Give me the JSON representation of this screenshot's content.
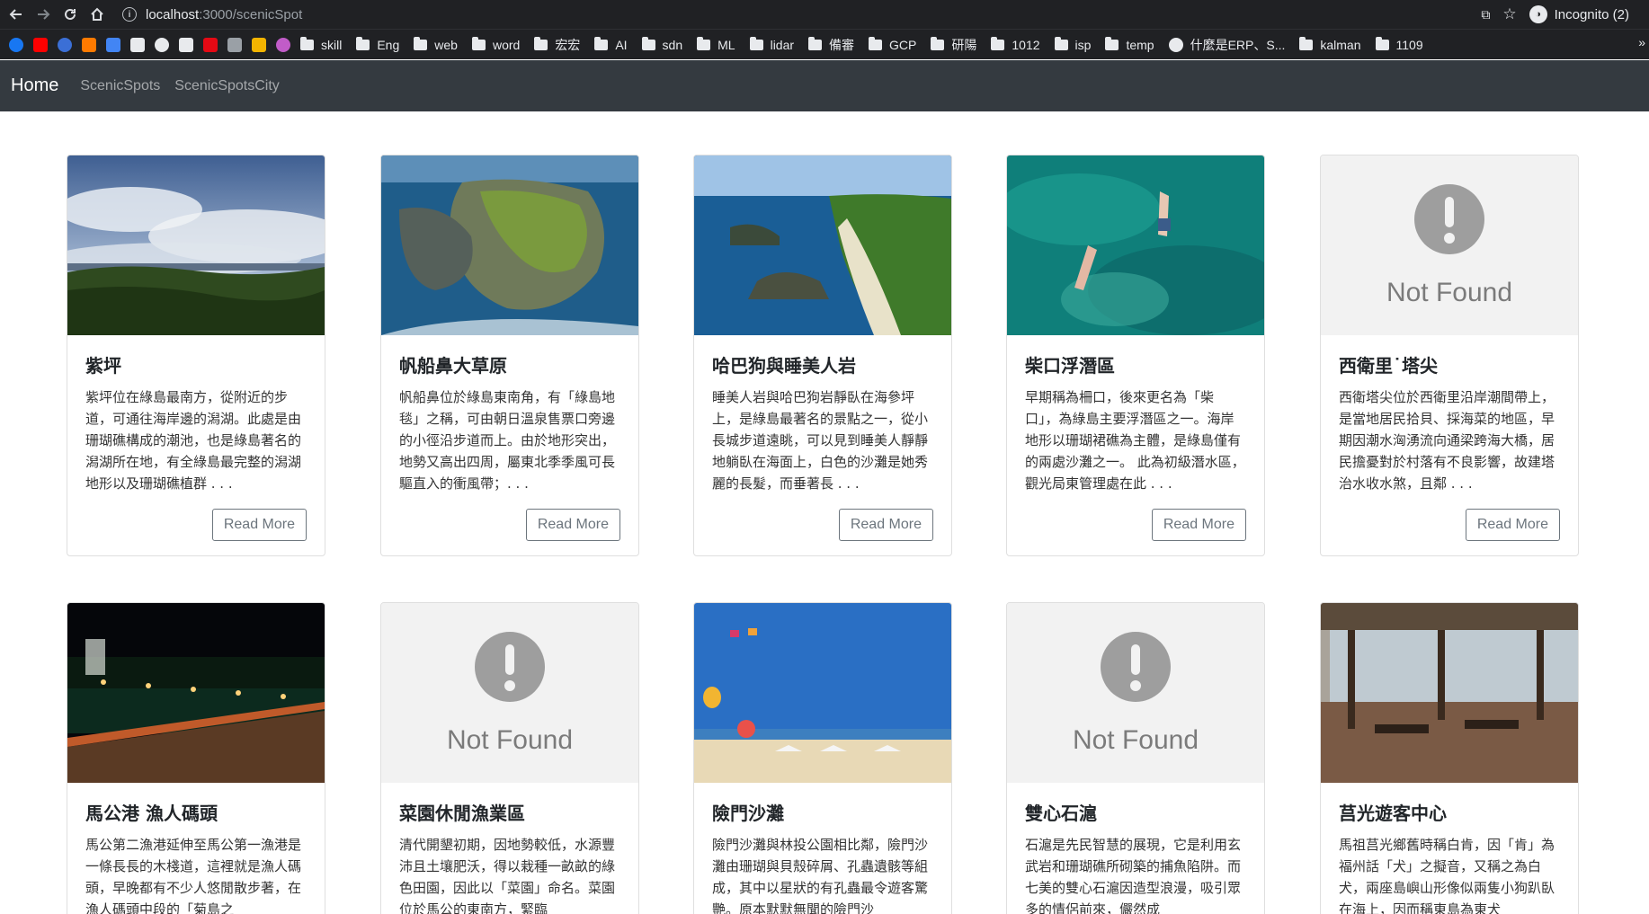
{
  "browser": {
    "url_host": "localhost",
    "url_path": ":3000/scenicSpot",
    "incognito_label": "Incognito (2)",
    "bookmarks": [
      "skill",
      "Eng",
      "web",
      "word",
      "宏宏",
      "AI",
      "sdn",
      "ML",
      "lidar",
      "備審",
      "GCP",
      "研陽",
      "1012",
      "isp",
      "temp",
      "什麼是ERP、S...",
      "kalman",
      "1109"
    ],
    "more": "»"
  },
  "navbar": {
    "brand": "Home",
    "links": [
      "ScenicSpots",
      "ScenicSpotsCity"
    ]
  },
  "not_found_text": "Not Found",
  "cards": [
    {
      "title": "紫坪",
      "image": "landscape-sky",
      "text": "紫坪位在綠島最南方，從附近的步道，可通往海岸邊的潟湖。此處是由珊瑚礁構成的潮池，也是綠島著名的潟湖所在地，有全綠島最完整的潟湖地形以及珊瑚礁植群 . . .",
      "button": "Read More"
    },
    {
      "title": "帆船鼻大草原",
      "image": "coast-aerial",
      "text": "帆船鼻位於綠島東南角，有「綠島地毯」之稱，可由朝日溫泉售票口旁邊的小徑沿步道而上。由於地形突出，地勢又高出四周，屬東北季季風可長驅直入的衝風帶；. . .",
      "button": "Read More"
    },
    {
      "title": "哈巴狗與睡美人岩",
      "image": "coast-islands",
      "text": "睡美人岩與哈巴狗岩靜臥在海參坪上，是綠島最著名的景點之一，從小長城步道遠眺，可以見到睡美人靜靜地躺臥在海面上，白色的沙灘是她秀麗的長髮，而垂著長 . . .",
      "button": "Read More"
    },
    {
      "title": "柴口浮潛區",
      "image": "snorkel",
      "text": "早期稱為柵口，後來更名為「柴口」，為綠島主要浮潛區之一。海岸地形以珊瑚裙礁為主體，是綠島僅有的兩處沙灘之一。 此為初級潛水區，觀光局東管理處在此 . . .",
      "button": "Read More"
    },
    {
      "title": "西衛里˙塔尖",
      "image": "not-found",
      "text": "西衛塔尖位於西衛里沿岸潮間帶上，是當地居民拾貝、採海菜的地區，早期因潮水洶湧流向通梁跨海大橋，居民擔憂對於村落有不良影響，故建塔治水收水煞，且鄰 . . .",
      "button": "Read More"
    },
    {
      "title": "馬公港 漁人碼頭",
      "image": "night-pier",
      "text": "馬公第二漁港延伸至馬公第一漁港是一條長長的木棧道，這裡就是漁人碼頭，早晚都有不少人悠閒散步著，在漁人碼頭中段的「菊島之",
      "button": "Read More"
    },
    {
      "title": "菜園休閒漁業區",
      "image": "not-found",
      "text": "清代開墾初期，因地勢較低，水源豐沛且土壤肥沃，得以栽種一畝畝的綠色田園，因此以「菜園」命名。菜園位於馬公的東南方，緊臨",
      "button": "Read More"
    },
    {
      "title": "險門沙灘",
      "image": "beach-kites",
      "text": "險門沙灘與林投公園相比鄰，險門沙灘由珊瑚與貝殼碎屑、孔蟲遺骸等組成，其中以星狀的有孔蟲最令遊客驚艷。原本默默無聞的險門沙",
      "button": "Read More"
    },
    {
      "title": "雙心石滬",
      "image": "not-found",
      "text": "石滬是先民智慧的展現，它是利用玄武岩和珊瑚礁所砌築的捕魚陷阱。而七美的雙心石滬因造型浪漫，吸引眾多的情侶前來，儼然成",
      "button": "Read More"
    },
    {
      "title": "莒光遊客中心",
      "image": "pavilion",
      "text": "馬祖莒光鄉舊時稱白肯，因「肯」為福州話「犬」之擬音，又稱之為白犬，兩座島嶼山形像似兩隻小狗趴臥在海上，因而稱東島為東犬",
      "button": "Read More"
    }
  ]
}
